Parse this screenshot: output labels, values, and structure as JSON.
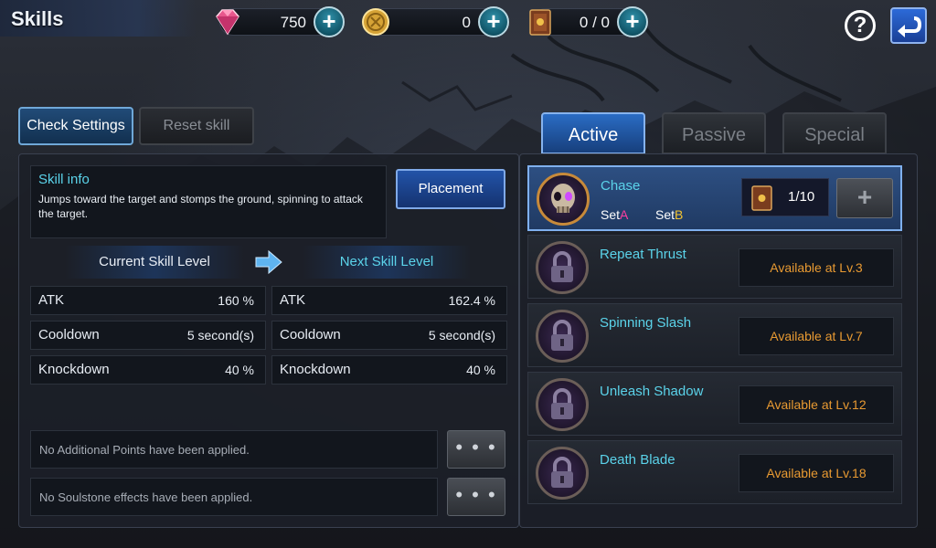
{
  "header": {
    "title": "Skills",
    "currencies": [
      {
        "icon": "gem-icon",
        "value": "750"
      },
      {
        "icon": "gold-coin-icon",
        "value": "0"
      },
      {
        "icon": "skill-book-icon",
        "value": "0 / 0"
      }
    ],
    "help_label": "?"
  },
  "left": {
    "check_settings_label": "Check Settings",
    "reset_skill_label": "Reset skill",
    "skill_info": {
      "heading": "Skill info",
      "description": "Jumps toward the target and stomps the ground, spinning to attack the target."
    },
    "placement_label": "Placement",
    "current_level_label": "Current Skill Level",
    "next_level_label": "Next Skill Level",
    "current_stats": [
      {
        "key": "ATK",
        "value": "160 %"
      },
      {
        "key": "Cooldown",
        "value": "5 second(s)"
      },
      {
        "key": "Knockdown",
        "value": "40 %"
      }
    ],
    "next_stats": [
      {
        "key": "ATK",
        "value": "162.4 %"
      },
      {
        "key": "Cooldown",
        "value": "5 second(s)"
      },
      {
        "key": "Knockdown",
        "value": "40 %"
      }
    ],
    "notes": [
      {
        "text": "No Additional Points have been applied.",
        "button": "• • •"
      },
      {
        "text": "No Soulstone effects have been applied.",
        "button": "• • •"
      }
    ]
  },
  "tabs": [
    {
      "label": "Active",
      "active": true
    },
    {
      "label": "Passive",
      "active": false
    },
    {
      "label": "Special",
      "active": false
    }
  ],
  "skills": [
    {
      "name": "Chase",
      "selected": true,
      "set_a_prefix": "Set",
      "set_a_mark": "A",
      "set_b_prefix": "Set",
      "set_b_mark": "B",
      "books": "1/10",
      "add_label": "+"
    },
    {
      "name": "Repeat Thrust",
      "availability": "Available at Lv.3"
    },
    {
      "name": "Spinning Slash",
      "availability": "Available at Lv.7"
    },
    {
      "name": "Unleash Shadow",
      "availability": "Available at Lv.12"
    },
    {
      "name": "Death Blade",
      "availability": "Available at Lv.18"
    }
  ],
  "colors": {
    "accent_cyan": "#5bd3ea",
    "availability_orange": "#e89a32",
    "active_blue": "#2a6cc4"
  }
}
